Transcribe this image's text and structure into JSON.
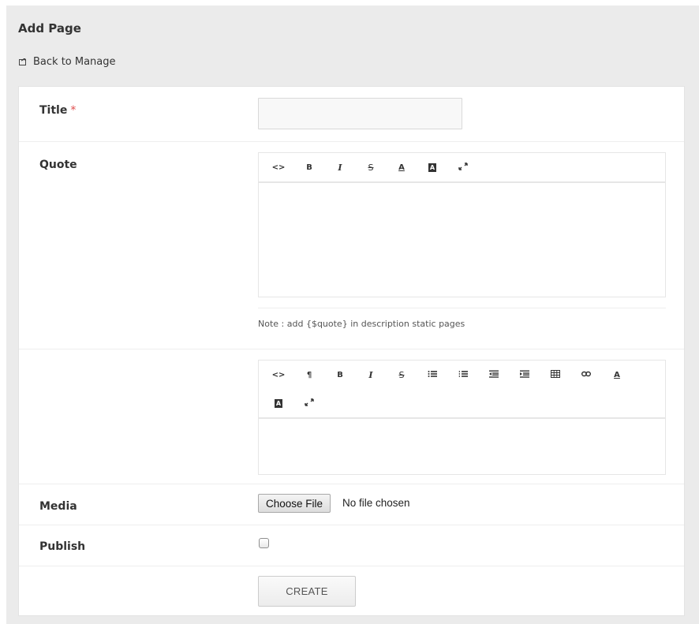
{
  "page": {
    "title": "Add Page",
    "back_label": "Back to Manage"
  },
  "form": {
    "title_label": "Title",
    "required_mark": "*",
    "title_value": "",
    "quote_label": "Quote",
    "quote_note": "Note : add {$quote} in description static pages",
    "media_label": "Media",
    "choose_file_label": "Choose File",
    "file_status": "No file chosen",
    "publish_label": "Publish",
    "publish_checked": false,
    "create_label": "CREATE"
  },
  "quote_toolbar": [
    {
      "name": "code-view-icon",
      "glyph": "<>"
    },
    {
      "name": "bold-icon",
      "glyph": "B"
    },
    {
      "name": "italic-icon",
      "glyph": "I"
    },
    {
      "name": "strikethrough-icon",
      "glyph": "S"
    },
    {
      "name": "font-color-icon",
      "glyph": "A"
    },
    {
      "name": "background-color-icon",
      "glyph": "A"
    },
    {
      "name": "fullscreen-icon",
      "glyph": "⤢"
    }
  ],
  "description_toolbar": [
    {
      "name": "code-view-icon",
      "glyph": "<>"
    },
    {
      "name": "paragraph-icon",
      "glyph": "¶"
    },
    {
      "name": "bold-icon",
      "glyph": "B"
    },
    {
      "name": "italic-icon",
      "glyph": "I"
    },
    {
      "name": "strikethrough-icon",
      "glyph": "S"
    },
    {
      "name": "unordered-list-icon",
      "glyph": "ul"
    },
    {
      "name": "ordered-list-icon",
      "glyph": "ol"
    },
    {
      "name": "outdent-icon",
      "glyph": "outdent"
    },
    {
      "name": "indent-icon",
      "glyph": "indent"
    },
    {
      "name": "table-icon",
      "glyph": "table"
    },
    {
      "name": "link-icon",
      "glyph": "link"
    },
    {
      "name": "font-color-icon",
      "glyph": "A"
    },
    {
      "name": "background-color-icon",
      "glyph": "A"
    },
    {
      "name": "fullscreen-icon",
      "glyph": "⤢"
    }
  ],
  "colors": {
    "panel_bg": "#ebebeb",
    "card_bg": "#ffffff",
    "required": "#e04e4e",
    "input_bg": "#f8f8f8"
  }
}
